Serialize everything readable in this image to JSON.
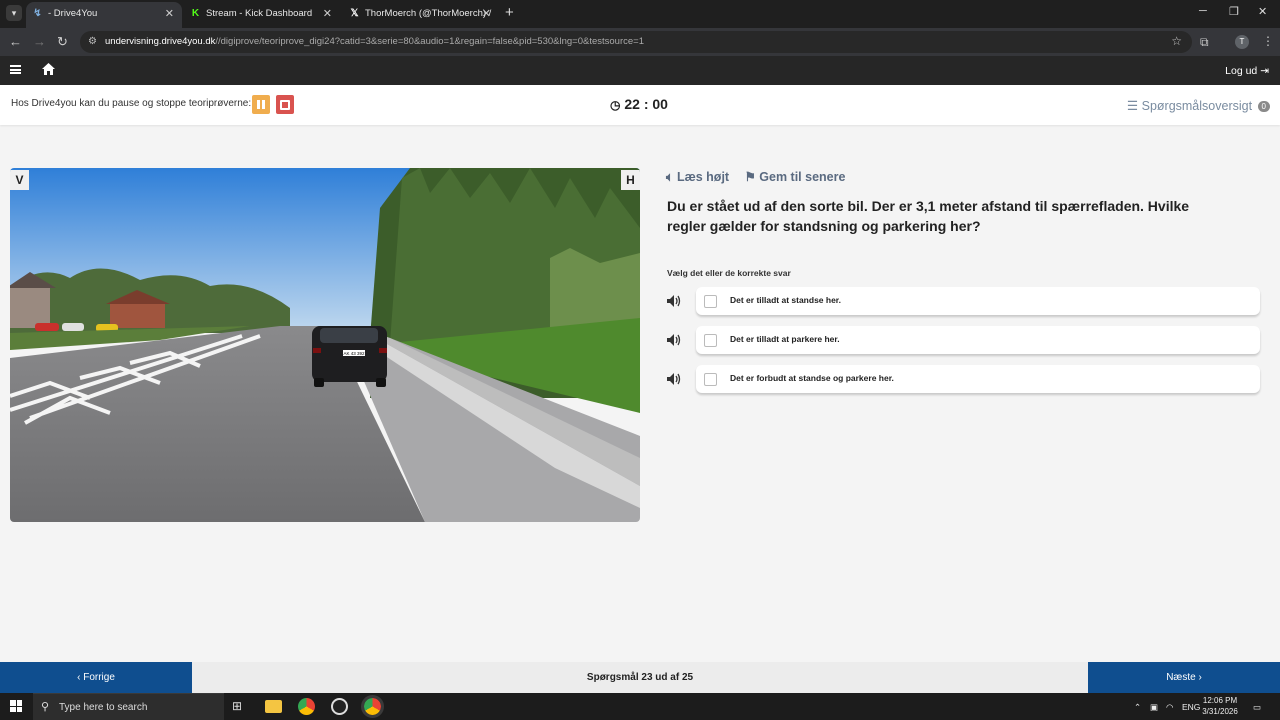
{
  "browser": {
    "tabs": [
      {
        "title": "- Drive4You",
        "active": true
      },
      {
        "title": "Stream - Kick Dashboard",
        "active": false
      },
      {
        "title": "ThorMoerch (@ThorMoerch) /",
        "active": false
      }
    ],
    "url_domain": "undervisning.drive4you.dk",
    "url_path": "//digiprove/teoriprove_digi24?catid=3&serie=80&audio=1&regain=false&pid=530&lng=0&testsource=1",
    "profile_initial": "T"
  },
  "site_nav": {
    "logout_label": "Log ud"
  },
  "infobar": {
    "pause_text": "Hos Drive4you kan du pause og stoppe teoriprøverne:",
    "timer": "22 : 00",
    "overview_label": "Spørgsmålsoversigt",
    "overview_count": "0"
  },
  "scene": {
    "corner_left": "V",
    "corner_right": "H",
    "plate": "AK 43 392"
  },
  "question": {
    "read_aloud_label": "Læs højt",
    "save_later_label": "Gem til senere",
    "text": "Du er stået ud af den sorte bil. Der er 3,1 meter afstand til spærrefladen. Hvilke regler gælder for standsning og parkering her?",
    "instruction": "Vælg det eller de korrekte svar",
    "answers": [
      {
        "label": "Det er tilladt at standse her.",
        "checked": false
      },
      {
        "label": "Det er tilladt at parkere her.",
        "checked": false
      },
      {
        "label": "Det er forbudt at standse og parkere her.",
        "checked": false
      }
    ]
  },
  "footer": {
    "prev_label": "Forrige",
    "next_label": "Næste",
    "progress": "Spørgsmål 23 ud af 25"
  },
  "taskbar": {
    "search_placeholder": "Type here to search",
    "lang": "ENG",
    "time": "12:06 PM",
    "date": "3/31/2026"
  },
  "colors": {
    "primary_blue": "#0f4e8f",
    "pause_orange": "#f0ad4e",
    "stop_red": "#d9534f"
  }
}
